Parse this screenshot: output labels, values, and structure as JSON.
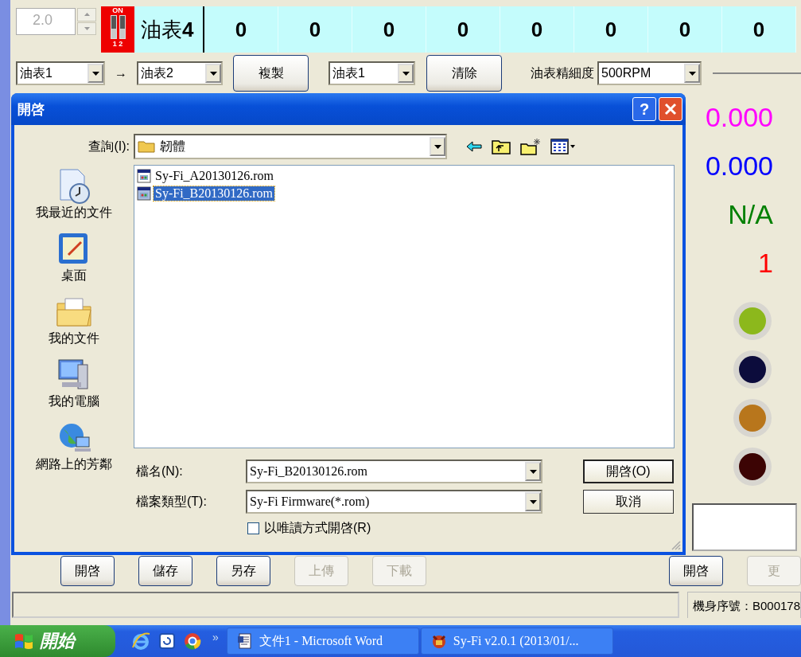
{
  "top_row": {
    "spin_value": "2.0",
    "dip_switch": {
      "on_label": "ON",
      "numbers": "1 2",
      "switches": [
        {
          "on": false
        },
        {
          "on": false
        }
      ]
    },
    "gauge_label": "油表**4**",
    "cells": [
      "0",
      "0",
      "0",
      "0",
      "0",
      "0",
      "0",
      "0"
    ]
  },
  "copy_row": {
    "source": "油表1",
    "arrow": "→",
    "target": "油表2",
    "copy_button": "複製",
    "clear_select": "油表1",
    "clear_button": "清除",
    "resolution_label": "油表精細度",
    "resolution": "500RPM"
  },
  "dialog": {
    "title": "開啓",
    "help_button": "?",
    "look_in_label": "查詢(I):",
    "look_in": "韌體",
    "places": [
      {
        "label": "我最近的文件",
        "kind": "recent"
      },
      {
        "label": "桌面",
        "kind": "desktop"
      },
      {
        "label": "我的文件",
        "kind": "documents"
      },
      {
        "label": "我的電腦",
        "kind": "computer"
      },
      {
        "label": "網路上的芳鄰",
        "kind": "network"
      }
    ],
    "files": [
      {
        "name": "Sy-Fi_A20130126.rom",
        "selected": false
      },
      {
        "name": "Sy-Fi_B20130126.rom",
        "selected": true
      }
    ],
    "file_name_label": "檔名(N):",
    "file_name": "Sy-Fi_B20130126.rom",
    "open_button": "開啓(O)",
    "file_type_label": "檔案類型(T):",
    "file_type": "Sy-Fi Firmware(*.rom)",
    "cancel_button": "取消",
    "readonly": {
      "label": "以唯讀方式開啓(R)",
      "checked": false
    }
  },
  "right_panel": {
    "readings": [
      {
        "text": "0.000",
        "color": "#ff00ff"
      },
      {
        "text": "0.000",
        "color": "#0000ff"
      },
      {
        "text": "N/A",
        "color": "#008000"
      },
      {
        "text": "1",
        "color": "#ff0000"
      }
    ],
    "leds": [
      {
        "color": "#8cb81c"
      },
      {
        "color": "#0c0c3c"
      },
      {
        "color": "#b8761c"
      },
      {
        "color": "#3c0404"
      }
    ],
    "buttons": [
      {
        "label": "開啓",
        "disabled": false
      },
      {
        "label": "更",
        "disabled": true
      }
    ]
  },
  "bottom_buttons": [
    {
      "label": "開啓",
      "disabled": false
    },
    {
      "label": "儲存",
      "disabled": false
    },
    {
      "label": "另存",
      "disabled": false
    },
    {
      "label": "上傳",
      "disabled": true
    },
    {
      "label": "下載",
      "disabled": true
    }
  ],
  "serial": "機身序號：B000178",
  "taskbar": {
    "start": "開始",
    "overflow": "»",
    "tasks": [
      {
        "label": "文件1 - Microsoft Word",
        "kind": "word"
      },
      {
        "label": "Sy-Fi v2.0.1 (2013/01/...",
        "kind": "app"
      }
    ]
  }
}
